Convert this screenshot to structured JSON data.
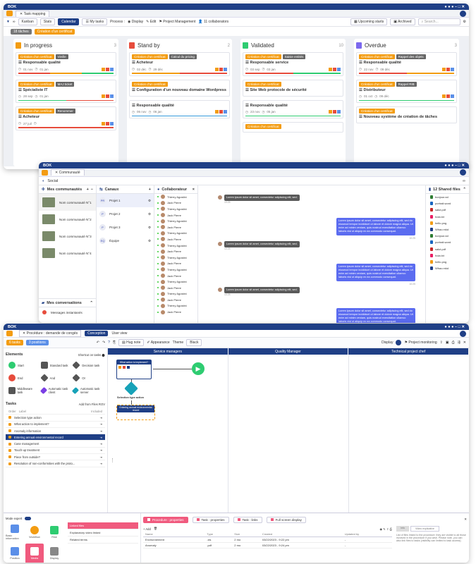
{
  "app": {
    "logo": "BOK"
  },
  "w1": {
    "tab_title": "Task mapping",
    "views": [
      "Kanban",
      "Stats",
      "Calendar"
    ],
    "my_tasks": "My tasks",
    "process_label": "Process :",
    "display": "Display",
    "edit": "Edit",
    "project": "Project Management",
    "collaborators": "11 collaborators",
    "upcoming": "Upcoming starts",
    "archived": "Archived",
    "search_placeholder": "Search...",
    "filter_count": "18 tâches",
    "filter_active": "Création d'un certificat",
    "columns": [
      {
        "title": "In progress",
        "count": "3",
        "color": "#f39c12",
        "cards": [
          {
            "tags": [
              "Création d'un certificat",
              "Vieille"
            ],
            "title": "Responsable qualité",
            "d1": "01 nov",
            "d2": "01 jan",
            "bar": [
              "#e74c3c",
              "#f39c12",
              "#2ecc71"
            ]
          },
          {
            "tags": [
              "Création d'un certificat",
              "MAJ ticket"
            ],
            "title": "Spécialiste IT",
            "d1": "28 sep",
            "d2": "01 jan",
            "bar": [
              "#2ecc71",
              "#e74c3c"
            ]
          },
          {
            "tags": [
              "Création d'un certificat",
              "Renommer"
            ],
            "title": "Acheteur",
            "d1": "27 juil",
            "d2": "",
            "bar": [
              "#e74c3c"
            ]
          }
        ]
      },
      {
        "title": "Stand by",
        "count": "2",
        "color": "#e74c3c",
        "cards": [
          {
            "tags": [
              "Création d'un certificat",
              "Calcul du pricing"
            ],
            "title": "Acheteur",
            "d1": "02 déc",
            "d2": "29 déc",
            "bar": [
              "#f39c12",
              "#e74c3c"
            ]
          },
          {
            "tags": [
              "Création d'un certificat"
            ],
            "title": "Configuration d'un nouveau domaine Wordpress",
            "d1": "",
            "d2": "",
            "bar": []
          },
          {
            "tags": [],
            "title": "Responsable qualité",
            "d1": "06 nov",
            "d2": "06 jan",
            "bar": [
              "#3498db"
            ]
          }
        ]
      },
      {
        "title": "Validated",
        "count": "10",
        "color": "#2ecc71",
        "cards": [
          {
            "tags": [
              "Création d'un certificat",
              "Saisie entités"
            ],
            "title": "Responsable service",
            "d1": "03 sep",
            "d2": "03 jan",
            "bar": [
              "#e74c3c",
              "#2ecc71"
            ]
          },
          {
            "tags": [
              "Création d'un certificat"
            ],
            "title": "Site Web protocole de sécurité",
            "d1": "",
            "d2": "",
            "bar": []
          },
          {
            "tags": [],
            "title": "Responsable qualité",
            "d1": "23 nov",
            "d2": "05 jan",
            "bar": [
              "#2ecc71"
            ]
          },
          {
            "tags": [
              "Création d'un certificat"
            ],
            "title": "",
            "d1": "",
            "d2": "",
            "bar": []
          }
        ]
      },
      {
        "title": "Overdue",
        "count": "3",
        "color": "#7b68ee",
        "cards": [
          {
            "tags": [
              "Création d'un certificat",
              "Rappel des objets"
            ],
            "title": "Responsable qualité",
            "d1": "22 nov",
            "d2": "09 déc",
            "bar": [
              "#e74c3c",
              "#f39c12"
            ]
          },
          {
            "tags": [
              "Création d'un certificat",
              "Rappel RIB"
            ],
            "title": "Distributeur",
            "d1": "01 oct",
            "d2": "09 déc",
            "bar": [
              "#2ecc71"
            ]
          },
          {
            "tags": [
              "Création d'un certificat"
            ],
            "title": "Nouveau système de création de tâches",
            "d1": "",
            "d2": "",
            "bar": []
          }
        ]
      }
    ]
  },
  "w2": {
    "tab_title": "Communauté",
    "social": "Social",
    "communities_title": "Mes communautés",
    "communities": [
      "Nom communauté N°1",
      "Nom communauté N°2",
      "Nom communauté N°3",
      "Nom communauté N°4"
    ],
    "conversations_title": "Mes conversations",
    "conversation_item": "Messages instantanés",
    "canaux_title": "Canaux",
    "canaux": [
      {
        "av": "PR",
        "name": "Projet 1"
      },
      {
        "av": "P",
        "name": "Projet 2"
      },
      {
        "av": "P",
        "name": "Projet 3"
      },
      {
        "av": "EQ",
        "name": "Équipe"
      }
    ],
    "collab_title": "Collaborateur",
    "collaborators": [
      "Thierry Agostini",
      "Jack Pierre",
      "Thierry Agostini",
      "Jack Pierre",
      "Thierry Agostini",
      "Jack Pierre",
      "Thierry Agostini",
      "Jack Pierre",
      "Thierry Agostini",
      "Jack Pierre",
      "Thierry Agostini",
      "Jack Pierre",
      "Thierry Agostini",
      "Jack Pierre",
      "Thierry Agostini",
      "Jack Pierre",
      "Thierry Agostini",
      "Jack Pierre",
      "Thierry Agostini",
      "Jack Pierre"
    ],
    "msg_short": "Lorem ipsum dolor sit amet, consectetur adipiscing elit, sed.",
    "msg_long": "Lorem ipsum dolor sit amet, consectetur adipiscing elit, sed do eiusmod tempor incididunt ut labore et dolore magna aliqua. Ut enim ad minim veniam, quis nostrud exercitation ullamco laboris nisi ut aliquip ex ea commodo consequat.",
    "time": "10:25",
    "shared_title": "12 Shared files",
    "files": [
      "bonjour.xcl",
      "portrait.word",
      "salut.pdf",
      "hola.txt",
      "hello.png",
      "Whao.mkd",
      "bonjour.xcl",
      "portrait.word",
      "salut.pdf",
      "hola.txt",
      "hello.png",
      "Whao.mkd"
    ]
  },
  "w3": {
    "tab_title": "Procédure : demande de congés",
    "tab_conception": "Conception",
    "tab_user": "User view",
    "tasks_btn": "6 tasks",
    "positions_btn": "3 positions",
    "hug_note": "Hug note",
    "appearance": "Appearance",
    "theme_label": "Theme",
    "theme_value": "Black",
    "display": "Display",
    "project": "Project monitoring",
    "elements_title": "Elements",
    "shortcut": "Shortcut on tasks",
    "elements": [
      "Start",
      "Standard task",
      "Decision task",
      "End",
      "And",
      "Or",
      "Middleware task",
      "Automatic task client",
      "Automatic task server"
    ],
    "tasks_title": "Tasks",
    "add_from": "Add from",
    "files": "Files",
    "rov": "ROV",
    "col_order": "Order",
    "col_label": "Label",
    "col_included": "Included",
    "tasks": [
      "Selection type action",
      "What action to implement?",
      "Anomaly information",
      "Entering annual environmental record",
      "Case management",
      "Touch-up treatment",
      "Piece from outside?",
      "Resolution of non-conformities with the proto..."
    ],
    "lanes": [
      "Service managers",
      "Quality Manager",
      "Technical project chef"
    ],
    "node1": "What action to implement?",
    "node2": "Selection type action",
    "node3": "Entering annual environmental record",
    "mode_expert": "Mode expert",
    "tiles": [
      "Basic information",
      "Workflow",
      "Risk",
      "Position",
      "Media",
      "Display"
    ],
    "sub_items": [
      "Linked files",
      "Explanatory video linked",
      "Related terms"
    ],
    "bottom_tabs": [
      "Procedure : properties",
      "Task : properties",
      "Task : links",
      "Full screen display"
    ],
    "add_label": "Add",
    "table_headers": [
      "Name",
      "Type",
      "Size",
      "Created",
      "Updated by"
    ],
    "rows": [
      [
        "Environnement",
        ".xls",
        "2 mo",
        "03/22/2023 - 9:22 pm",
        "-"
      ],
      [
        "Anomaly",
        ".pdf",
        "2 mo",
        "03/22/2023 - 9:24 pm",
        "-"
      ]
    ],
    "sub_tab_a": "Info",
    "sub_tab_b": "Video explicative",
    "help": "List of files linked to the procedure: they are visible to all those involved in the procedure if you wish. Please note, you can also link files to tasks (visibility can limited to task access)."
  }
}
